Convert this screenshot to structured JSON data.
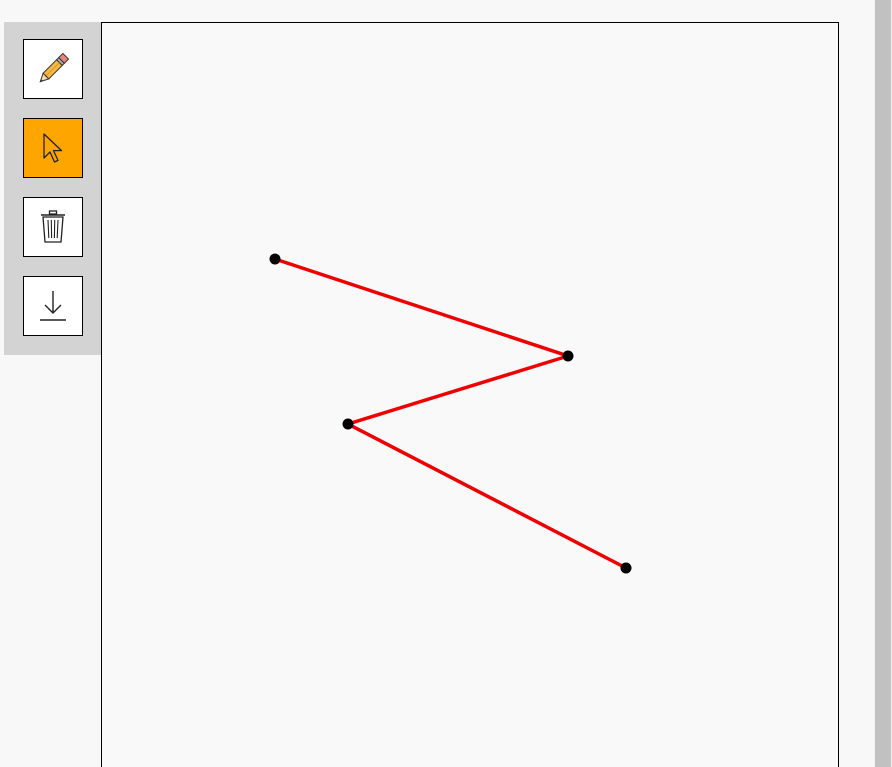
{
  "toolbar": {
    "active_color": "#ffa500",
    "tools": [
      {
        "name": "pencil",
        "icon": "pencil-icon",
        "active": false
      },
      {
        "name": "select",
        "icon": "cursor-arrow-icon",
        "active": true
      },
      {
        "name": "delete",
        "icon": "trash-icon",
        "active": false
      },
      {
        "name": "download",
        "icon": "download-icon",
        "active": false
      }
    ]
  },
  "canvas": {
    "line_color": "#ee0000",
    "point_color": "#000000"
  }
}
